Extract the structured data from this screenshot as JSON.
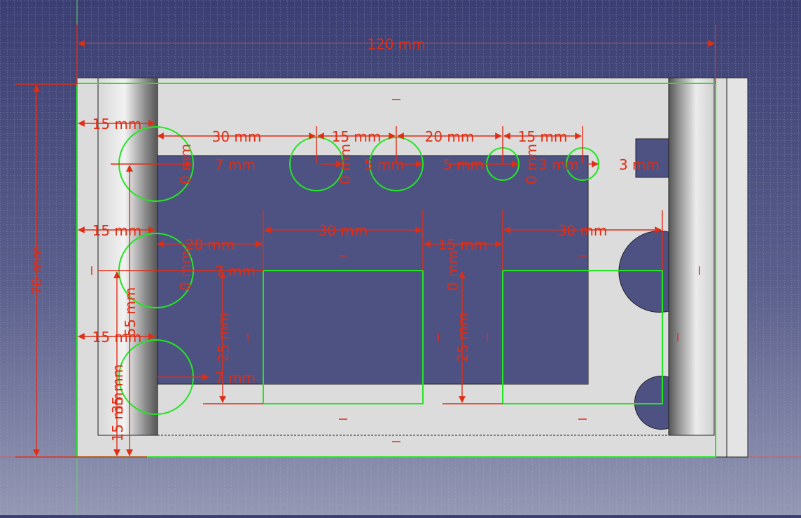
{
  "app": {
    "title": ""
  },
  "colors": {
    "background_top": "#3a3e72",
    "background_bottom": "#9498b4",
    "grid": "#c8cbe6",
    "part_face": "#dcdcdc",
    "pocket": "#4e5283",
    "geometry": "#22e622",
    "dimension": "#e02d14",
    "axis_y": "#66d066",
    "axis_x": "#e05050"
  },
  "dimensions": {
    "overall_width": "120 mm",
    "overall_height": "70 mm",
    "d1": "15 mm",
    "d2": "30 mm",
    "d3": "15 mm",
    "d4": "20 mm",
    "d5": "15 mm",
    "d6": "7 mm",
    "d7": "0 mm",
    "d8": "0 mm",
    "d9": "5 mm",
    "d10": "5 mm",
    "d11": "0 mm",
    "d12": "3 mm",
    "d13": "3 mm",
    "d14": "15 mm",
    "d15": "20 mm",
    "d16": "30 mm",
    "d17": "15 mm",
    "d18": "30 mm",
    "d19": "0 mm",
    "d20": "7 mm",
    "d21": "0 mm",
    "d22": "55 mm",
    "d23": "25 mm",
    "d24": "25 mm",
    "d25": "15 mm",
    "d26": "35 mm",
    "d27": "7 mm",
    "d28": "15 mm"
  }
}
